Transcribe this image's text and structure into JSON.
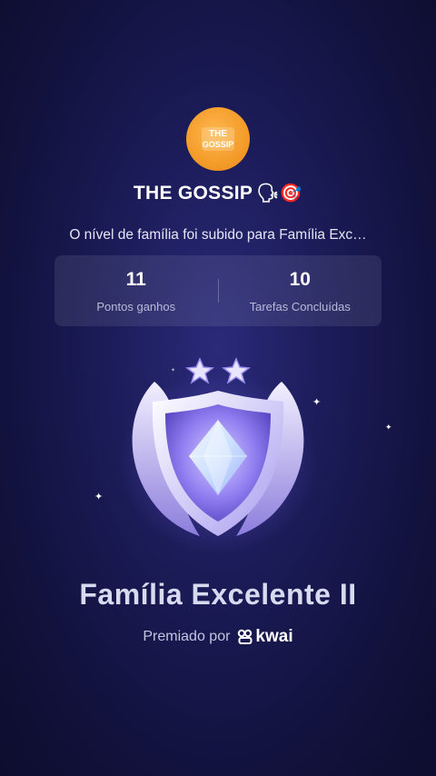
{
  "avatar": {
    "line1": "THE",
    "line2": "GOSSIP"
  },
  "family": {
    "name": "THE GOSSIP",
    "emojis": "🗣🎯"
  },
  "message": "O nível de família foi subido para Família Exc…",
  "stats": [
    {
      "value": "11",
      "label": "Pontos ganhos"
    },
    {
      "value": "10",
      "label": "Tarefas Concluídas"
    }
  ],
  "badge": {
    "stars": 2,
    "icon": "family-level-shield-icon"
  },
  "level_name": "Família Excelente II",
  "awarded": {
    "prefix": "Premiado por",
    "brand": "kwai"
  },
  "colors": {
    "background": "#1c1c5a",
    "avatar": "#f39c2a",
    "badge": "#b8a9ff"
  }
}
